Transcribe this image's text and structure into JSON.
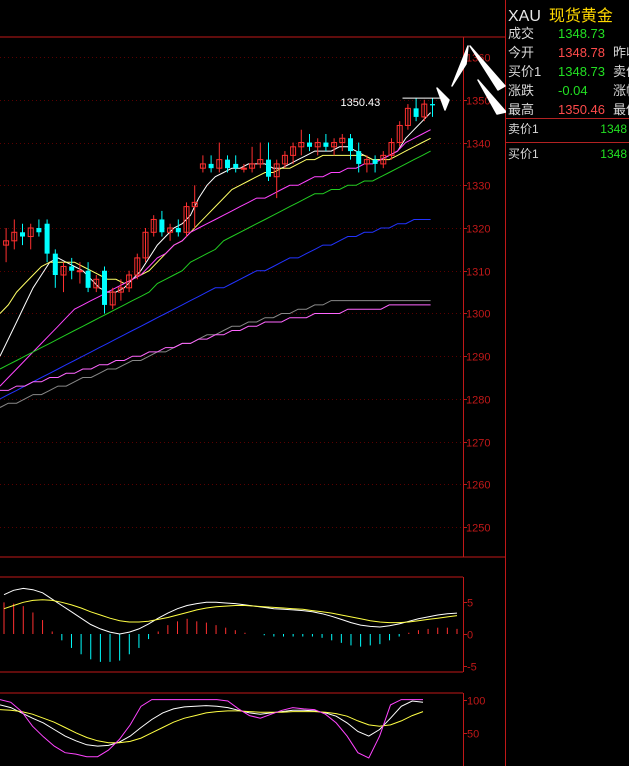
{
  "header": {
    "code": "XAU",
    "name": "现货黄金"
  },
  "quote": [
    {
      "label": "成交",
      "value": "1348.73",
      "color": "green",
      "label2": ""
    },
    {
      "label": "今开",
      "value": "1348.78",
      "color": "red",
      "label2": "昨收"
    },
    {
      "label": "买价1",
      "value": "1348.73",
      "color": "green",
      "label2": "卖价"
    },
    {
      "label": "涨跌",
      "value": "-0.04",
      "color": "green",
      "label2": "涨幅"
    },
    {
      "label": "最高",
      "value": "1350.46",
      "color": "red",
      "label2": "最低"
    }
  ],
  "orderbook": {
    "sell": {
      "label": "卖价1",
      "value": "1348"
    },
    "buy": {
      "label": "买价1",
      "value": "1348"
    }
  },
  "chart_data": [
    {
      "type": "candlestick",
      "annotation": "1350.43",
      "y_ticks": [
        1250,
        1260,
        1270,
        1280,
        1290,
        1300,
        1310,
        1320,
        1330,
        1340,
        1350,
        1360
      ],
      "ylim": [
        1243,
        1364
      ],
      "grid": true,
      "candles": [
        {
          "o": 1316,
          "h": 1320,
          "l": 1312,
          "c": 1317
        },
        {
          "o": 1317,
          "h": 1322,
          "l": 1315,
          "c": 1319
        },
        {
          "o": 1319,
          "h": 1321,
          "l": 1316,
          "c": 1318
        },
        {
          "o": 1318,
          "h": 1321,
          "l": 1315,
          "c": 1320
        },
        {
          "o": 1320,
          "h": 1322,
          "l": 1318,
          "c": 1319
        },
        {
          "o": 1321,
          "h": 1322,
          "l": 1312,
          "c": 1314
        },
        {
          "o": 1314,
          "h": 1315,
          "l": 1306,
          "c": 1309
        },
        {
          "o": 1309,
          "h": 1312,
          "l": 1305,
          "c": 1311
        },
        {
          "o": 1311,
          "h": 1313,
          "l": 1308,
          "c": 1310
        },
        {
          "o": 1310,
          "h": 1312,
          "l": 1307,
          "c": 1310
        },
        {
          "o": 1310,
          "h": 1312,
          "l": 1305,
          "c": 1306
        },
        {
          "o": 1306,
          "h": 1309,
          "l": 1305,
          "c": 1308
        },
        {
          "o": 1310,
          "h": 1311,
          "l": 1300,
          "c": 1302
        },
        {
          "o": 1302,
          "h": 1306,
          "l": 1301,
          "c": 1305
        },
        {
          "o": 1305,
          "h": 1308,
          "l": 1303,
          "c": 1306
        },
        {
          "o": 1306,
          "h": 1310,
          "l": 1305,
          "c": 1309
        },
        {
          "o": 1309,
          "h": 1314,
          "l": 1308,
          "c": 1313
        },
        {
          "o": 1313,
          "h": 1320,
          "l": 1312,
          "c": 1319
        },
        {
          "o": 1319,
          "h": 1323,
          "l": 1318,
          "c": 1322
        },
        {
          "o": 1322,
          "h": 1324,
          "l": 1318,
          "c": 1319
        },
        {
          "o": 1319,
          "h": 1321,
          "l": 1317,
          "c": 1320
        },
        {
          "o": 1320,
          "h": 1322,
          "l": 1318,
          "c": 1319
        },
        {
          "o": 1319,
          "h": 1326,
          "l": 1318,
          "c": 1325
        },
        {
          "o": 1325,
          "h": 1330,
          "l": 1320,
          "c": 1326
        },
        {
          "o": 1334,
          "h": 1337,
          "l": 1333,
          "c": 1335
        },
        {
          "o": 1335,
          "h": 1337,
          "l": 1333,
          "c": 1334
        },
        {
          "o": 1334,
          "h": 1340,
          "l": 1333,
          "c": 1336
        },
        {
          "o": 1336,
          "h": 1337,
          "l": 1333,
          "c": 1334
        },
        {
          "o": 1335,
          "h": 1337,
          "l": 1333,
          "c": 1334
        },
        {
          "o": 1334,
          "h": 1335,
          "l": 1333,
          "c": 1334
        },
        {
          "o": 1334,
          "h": 1339,
          "l": 1333,
          "c": 1335
        },
        {
          "o": 1335,
          "h": 1340,
          "l": 1334,
          "c": 1336
        },
        {
          "o": 1336,
          "h": 1340,
          "l": 1331,
          "c": 1332
        },
        {
          "o": 1332,
          "h": 1336,
          "l": 1327,
          "c": 1335
        },
        {
          "o": 1335,
          "h": 1338,
          "l": 1334,
          "c": 1337
        },
        {
          "o": 1337,
          "h": 1340,
          "l": 1335,
          "c": 1339
        },
        {
          "o": 1339,
          "h": 1343,
          "l": 1337,
          "c": 1340
        },
        {
          "o": 1340,
          "h": 1342,
          "l": 1338,
          "c": 1339
        },
        {
          "o": 1339,
          "h": 1341,
          "l": 1337,
          "c": 1340
        },
        {
          "o": 1340,
          "h": 1342,
          "l": 1338,
          "c": 1339
        },
        {
          "o": 1339,
          "h": 1341,
          "l": 1337,
          "c": 1340
        },
        {
          "o": 1340,
          "h": 1342,
          "l": 1338,
          "c": 1341
        },
        {
          "o": 1341,
          "h": 1342,
          "l": 1336,
          "c": 1338
        },
        {
          "o": 1338,
          "h": 1340,
          "l": 1333,
          "c": 1335
        },
        {
          "o": 1335,
          "h": 1337,
          "l": 1333,
          "c": 1336
        },
        {
          "o": 1336,
          "h": 1337,
          "l": 1333,
          "c": 1335
        },
        {
          "o": 1335,
          "h": 1338,
          "l": 1334,
          "c": 1337
        },
        {
          "o": 1337,
          "h": 1341,
          "l": 1336,
          "c": 1340
        },
        {
          "o": 1340,
          "h": 1345,
          "l": 1339,
          "c": 1344
        },
        {
          "o": 1344,
          "h": 1349,
          "l": 1343,
          "c": 1348
        },
        {
          "o": 1348,
          "h": 1350.4,
          "l": 1345,
          "c": 1346
        },
        {
          "o": 1346,
          "h": 1350,
          "l": 1345,
          "c": 1349
        },
        {
          "o": 1349,
          "h": 1350.4,
          "l": 1346,
          "c": 1348.7
        }
      ],
      "ma_lines": [
        {
          "color": "#ffffff",
          "values": [
            1290,
            1294,
            1298,
            1302,
            1306,
            1309,
            1312,
            1313,
            1312,
            1311,
            1310,
            1308,
            1306,
            1305,
            1305,
            1306,
            1308,
            1310,
            1313,
            1316,
            1318,
            1320,
            1321,
            1323,
            1327,
            1330,
            1332,
            1333,
            1334,
            1334,
            1335,
            1335,
            1335,
            1334,
            1334,
            1335,
            1336,
            1337,
            1338,
            1338,
            1338,
            1339,
            1339,
            1338,
            1337,
            1336,
            1336,
            1337,
            1338,
            1341,
            1343,
            1345,
            1347
          ]
        },
        {
          "color": "#ffff66",
          "values": [
            1300,
            1302,
            1305,
            1307,
            1309,
            1311,
            1312,
            1312,
            1312,
            1312,
            1311,
            1310,
            1309,
            1308,
            1308,
            1307,
            1308,
            1309,
            1310,
            1312,
            1314,
            1316,
            1317,
            1319,
            1321,
            1323,
            1325,
            1327,
            1329,
            1330,
            1331,
            1332,
            1333,
            1333,
            1334,
            1334,
            1335,
            1336,
            1336,
            1337,
            1337,
            1337,
            1337,
            1337,
            1337,
            1336,
            1336,
            1336,
            1337,
            1338,
            1339,
            1340,
            1341
          ]
        },
        {
          "color": "#ff44ff",
          "values": [
            1283,
            1285,
            1287,
            1289,
            1291,
            1293,
            1295,
            1297,
            1299,
            1301,
            1302,
            1303,
            1304,
            1305,
            1306,
            1307,
            1308,
            1309,
            1311,
            1313,
            1314,
            1316,
            1317,
            1319,
            1320,
            1321,
            1322,
            1323,
            1324,
            1325,
            1326,
            1327,
            1327,
            1328,
            1329,
            1330,
            1330,
            1331,
            1332,
            1332,
            1333,
            1333,
            1334,
            1334,
            1335,
            1335,
            1336,
            1337,
            1338,
            1340,
            1341,
            1342,
            1343
          ]
        },
        {
          "color": "#22cc22",
          "values": [
            1287,
            1288,
            1289,
            1290,
            1291,
            1292,
            1293,
            1294,
            1295,
            1296,
            1297,
            1298,
            1299,
            1300,
            1301,
            1302,
            1303,
            1304,
            1305,
            1307,
            1308,
            1309,
            1310,
            1312,
            1313,
            1314,
            1315,
            1317,
            1318,
            1319,
            1320,
            1321,
            1322,
            1323,
            1324,
            1325,
            1326,
            1327,
            1328,
            1328,
            1329,
            1329,
            1330,
            1330,
            1331,
            1331,
            1332,
            1333,
            1334,
            1335,
            1336,
            1337,
            1338
          ]
        },
        {
          "color": "#2233ff",
          "values": [
            1280,
            1281,
            1282,
            1283,
            1284,
            1285,
            1286,
            1287,
            1288,
            1289,
            1290,
            1291,
            1292,
            1293,
            1294,
            1295,
            1296,
            1297,
            1298,
            1299,
            1300,
            1301,
            1302,
            1303,
            1304,
            1305,
            1306,
            1306,
            1307,
            1308,
            1309,
            1310,
            1310,
            1311,
            1312,
            1313,
            1313,
            1314,
            1315,
            1316,
            1316,
            1317,
            1318,
            1318,
            1319,
            1319,
            1320,
            1320,
            1321,
            1321,
            1322,
            1322,
            1322
          ]
        },
        {
          "color": "#888888",
          "values": [
            1278,
            1279,
            1279,
            1280,
            1281,
            1281,
            1282,
            1283,
            1283,
            1284,
            1285,
            1285,
            1286,
            1287,
            1287,
            1288,
            1289,
            1289,
            1290,
            1291,
            1291,
            1292,
            1293,
            1293,
            1294,
            1295,
            1295,
            1296,
            1297,
            1297,
            1298,
            1298,
            1299,
            1299,
            1300,
            1300,
            1301,
            1301,
            1302,
            1302,
            1303,
            1303,
            1303,
            1303,
            1303,
            1303,
            1303,
            1303,
            1303,
            1303,
            1303,
            1303,
            1303
          ]
        },
        {
          "color": "#ff66ff",
          "values": [
            1282,
            1282,
            1283,
            1283,
            1284,
            1284,
            1285,
            1285,
            1286,
            1286,
            1287,
            1287,
            1288,
            1288,
            1289,
            1289,
            1290,
            1290,
            1291,
            1291,
            1292,
            1292,
            1293,
            1293,
            1294,
            1294,
            1295,
            1295,
            1296,
            1296,
            1297,
            1297,
            1298,
            1298,
            1298,
            1299,
            1299,
            1299,
            1300,
            1300,
            1300,
            1300,
            1301,
            1301,
            1301,
            1301,
            1301,
            1302,
            1302,
            1302,
            1302,
            1302,
            1302
          ]
        }
      ]
    },
    {
      "type": "macd",
      "y_ticks": [
        -5,
        0,
        5
      ],
      "ylim": [
        -6,
        9
      ],
      "dif": [
        6.2,
        6.9,
        7.2,
        7.0,
        6.5,
        5.5,
        4.5,
        3.5,
        2.5,
        1.5,
        0.8,
        0.3,
        0.0,
        0.3,
        0.8,
        1.6,
        2.5,
        3.3,
        4.0,
        4.5,
        4.8,
        5.0,
        5.0,
        4.9,
        4.8,
        4.6,
        4.4,
        4.2,
        4.0,
        3.9,
        3.8,
        3.7,
        3.5,
        3.2,
        2.8,
        2.3,
        1.8,
        1.4,
        1.2,
        1.1,
        1.3,
        1.6,
        2.0,
        2.4,
        2.7,
        3.0,
        3.2,
        3.3
      ],
      "dea": [
        4.0,
        4.5,
        5.0,
        5.3,
        5.4,
        5.3,
        5.0,
        4.6,
        4.1,
        3.5,
        3.0,
        2.5,
        2.1,
        1.9,
        1.9,
        2.0,
        2.3,
        2.6,
        3.0,
        3.4,
        3.8,
        4.1,
        4.3,
        4.4,
        4.5,
        4.5,
        4.4,
        4.3,
        4.2,
        4.1,
        4.0,
        3.9,
        3.7,
        3.5,
        3.3,
        3.0,
        2.7,
        2.4,
        2.1,
        1.9,
        1.8,
        1.8,
        1.9,
        2.1,
        2.3,
        2.5,
        2.7,
        2.9
      ],
      "hist": [
        5.0,
        4.8,
        4.4,
        3.4,
        2.2,
        0.4,
        -1.0,
        -2.2,
        -3.2,
        -4.0,
        -4.4,
        -4.4,
        -4.2,
        -3.2,
        -2.2,
        -0.8,
        0.4,
        1.4,
        2.0,
        2.4,
        2.0,
        1.8,
        1.4,
        1.0,
        0.6,
        0.2,
        0.0,
        -0.2,
        -0.4,
        -0.4,
        -0.4,
        -0.4,
        -0.4,
        -0.6,
        -1.0,
        -1.4,
        -1.8,
        -2.0,
        -1.8,
        -1.6,
        -1.0,
        -0.4,
        0.2,
        0.6,
        0.8,
        1.0,
        1.0,
        0.8
      ]
    },
    {
      "type": "kdj",
      "y_ticks": [
        50,
        100
      ],
      "ylim": [
        0,
        110
      ],
      "k": [
        92,
        88,
        80,
        72,
        65,
        55,
        45,
        38,
        32,
        30,
        31,
        36,
        45,
        58,
        70,
        80,
        86,
        89,
        90,
        91,
        90,
        88,
        84,
        80,
        78,
        80,
        82,
        84,
        84,
        83,
        80,
        75,
        65,
        52,
        45,
        55,
        72,
        90,
        98,
        96
      ],
      "d": [
        85,
        84,
        82,
        78,
        72,
        66,
        58,
        50,
        43,
        38,
        35,
        35,
        37,
        42,
        50,
        58,
        66,
        72,
        76,
        80,
        82,
        83,
        83,
        82,
        81,
        81,
        81,
        82,
        82,
        82,
        81,
        79,
        75,
        68,
        62,
        60,
        62,
        68,
        76,
        82
      ],
      "j": [
        100,
        96,
        82,
        60,
        44,
        30,
        20,
        18,
        14,
        14,
        24,
        40,
        62,
        90,
        100,
        100,
        100,
        100,
        100,
        100,
        100,
        98,
        86,
        76,
        72,
        78,
        84,
        88,
        86,
        85,
        78,
        65,
        45,
        20,
        12,
        45,
        92,
        100,
        100,
        100
      ]
    }
  ]
}
